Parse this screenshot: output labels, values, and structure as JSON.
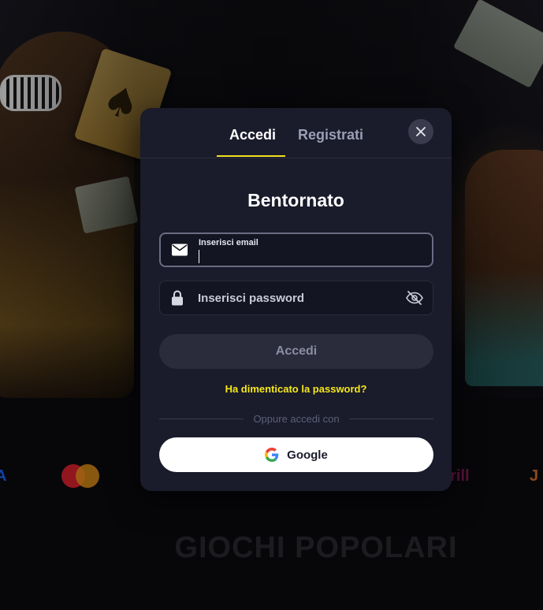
{
  "background": {
    "section_title": "GIOCHI POPOLARI",
    "payments": {
      "visa_fragment": "A",
      "skrill_fragment": "krill",
      "j_fragment": "J"
    }
  },
  "modal": {
    "tabs": {
      "login": "Accedi",
      "register": "Registrati"
    },
    "title": "Bentornato",
    "email": {
      "label": "Inserisci email",
      "value": ""
    },
    "password": {
      "placeholder": "Inserisci password"
    },
    "submit_label": "Accedi",
    "forgot_label": "Ha dimenticato la password?",
    "divider_label": "Oppure accedi con",
    "google_label": "Google"
  },
  "colors": {
    "accent": "#f0e11f",
    "modal_bg": "#1a1b2b",
    "forgot_text": "#f5e81a"
  },
  "icons": {
    "close": "close-icon",
    "email": "envelope-icon",
    "password": "lock-icon",
    "toggle_visibility": "eye-slash-icon",
    "google": "google-logo-icon"
  }
}
